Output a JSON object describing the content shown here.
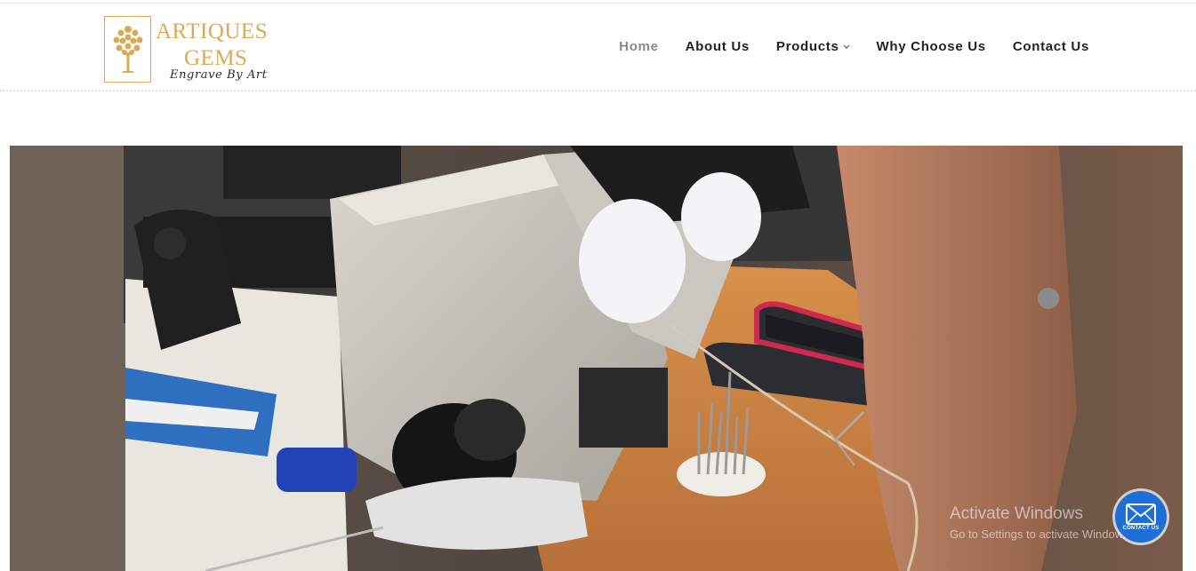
{
  "brand": {
    "name_line1": "ARTIQUES",
    "name_line2": "GEMS",
    "tagline": "Engrave By Art",
    "color": "#d8ab55",
    "icon": "tree-icon"
  },
  "nav": {
    "items": [
      {
        "label": "Home",
        "active": true
      },
      {
        "label": "About Us"
      },
      {
        "label": "Products",
        "has_dropdown": true
      },
      {
        "label": "Why Choose Us"
      },
      {
        "label": "Contact Us"
      }
    ]
  },
  "hero": {
    "scene": "jeweller using a stereo microscope at an engraving bench",
    "icon": "video-frame"
  },
  "watermark": {
    "title": "Activate Windows",
    "subtitle": "Go to Settings to activate Windows."
  },
  "contact_button": {
    "label": "CONTACT US",
    "icon": "envelope-icon",
    "color": "#1e6ed8"
  }
}
